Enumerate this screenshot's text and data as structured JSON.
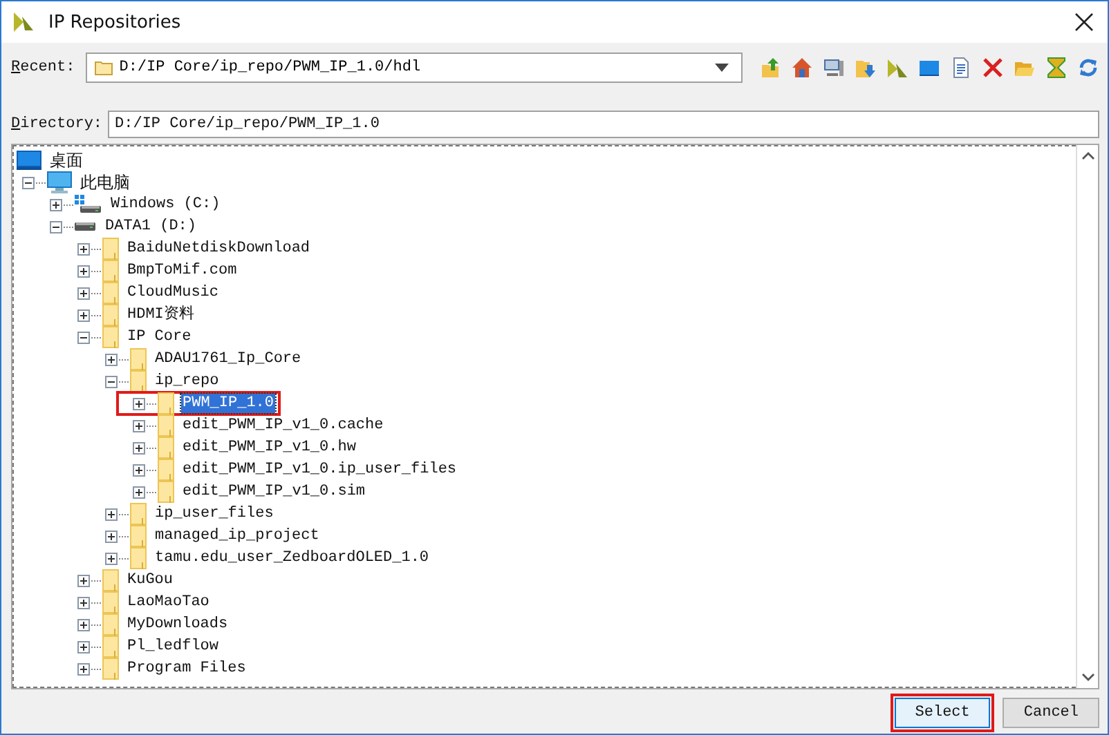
{
  "window": {
    "title": "IP Repositories"
  },
  "recent": {
    "label": "Recent:",
    "value": "D:/IP Core/ip_repo/PWM_IP_1.0/hdl"
  },
  "directory": {
    "label": "Directory:",
    "value": "D:/IP Core/ip_repo/PWM_IP_1.0"
  },
  "tree": [
    {
      "label": "桌面",
      "kind": "desktop",
      "selected": false,
      "children": [
        {
          "label": "此电脑",
          "kind": "computer",
          "expanded": true,
          "selected": false,
          "children": [
            {
              "label": "Windows (C:)",
              "kind": "system-drive",
              "expanded": false,
              "selected": false
            },
            {
              "label": "DATA1 (D:)",
              "kind": "drive",
              "expanded": true,
              "selected": false,
              "children": [
                {
                  "label": "BaiduNetdiskDownload",
                  "kind": "folder",
                  "expanded": false,
                  "selected": false
                },
                {
                  "label": "BmpToMif.com",
                  "kind": "folder",
                  "expanded": false,
                  "selected": false
                },
                {
                  "label": "CloudMusic",
                  "kind": "folder",
                  "expanded": false,
                  "selected": false
                },
                {
                  "label": "HDMI资料",
                  "kind": "folder",
                  "expanded": false,
                  "selected": false
                },
                {
                  "label": "IP Core",
                  "kind": "folder",
                  "expanded": true,
                  "selected": false,
                  "children": [
                    {
                      "label": "ADAU1761_Ip_Core",
                      "kind": "folder",
                      "expanded": false,
                      "selected": false
                    },
                    {
                      "label": "ip_repo",
                      "kind": "folder",
                      "expanded": true,
                      "selected": false,
                      "children": [
                        {
                          "label": "PWM_IP_1.0",
                          "kind": "folder",
                          "expanded": false,
                          "selected": true,
                          "annotated": true
                        },
                        {
                          "label": "edit_PWM_IP_v1_0.cache",
                          "kind": "folder",
                          "expanded": false,
                          "selected": false
                        },
                        {
                          "label": "edit_PWM_IP_v1_0.hw",
                          "kind": "folder",
                          "expanded": false,
                          "selected": false
                        },
                        {
                          "label": "edit_PWM_IP_v1_0.ip_user_files",
                          "kind": "folder",
                          "expanded": false,
                          "selected": false
                        },
                        {
                          "label": "edit_PWM_IP_v1_0.sim",
                          "kind": "folder",
                          "expanded": false,
                          "selected": false
                        }
                      ]
                    },
                    {
                      "label": "ip_user_files",
                      "kind": "folder",
                      "expanded": false,
                      "selected": false
                    },
                    {
                      "label": "managed_ip_project",
                      "kind": "folder",
                      "expanded": false,
                      "selected": false
                    },
                    {
                      "label": "tamu.edu_user_ZedboardOLED_1.0",
                      "kind": "folder",
                      "expanded": false,
                      "selected": false
                    }
                  ]
                },
                {
                  "label": "KuGou",
                  "kind": "folder",
                  "expanded": false,
                  "selected": false
                },
                {
                  "label": "LaoMaoTao",
                  "kind": "folder",
                  "expanded": false,
                  "selected": false
                },
                {
                  "label": "MyDownloads",
                  "kind": "folder",
                  "expanded": false,
                  "selected": false
                },
                {
                  "label": "Pl_ledflow",
                  "kind": "folder",
                  "expanded": false,
                  "selected": false
                },
                {
                  "label": "Program Files",
                  "kind": "folder",
                  "expanded": false,
                  "selected": false
                }
              ]
            }
          ]
        }
      ]
    }
  ],
  "buttons": [
    {
      "label": "Select",
      "disabled": false,
      "annotated": true
    },
    {
      "label": "Cancel",
      "disabled": false,
      "annotated": false
    }
  ]
}
